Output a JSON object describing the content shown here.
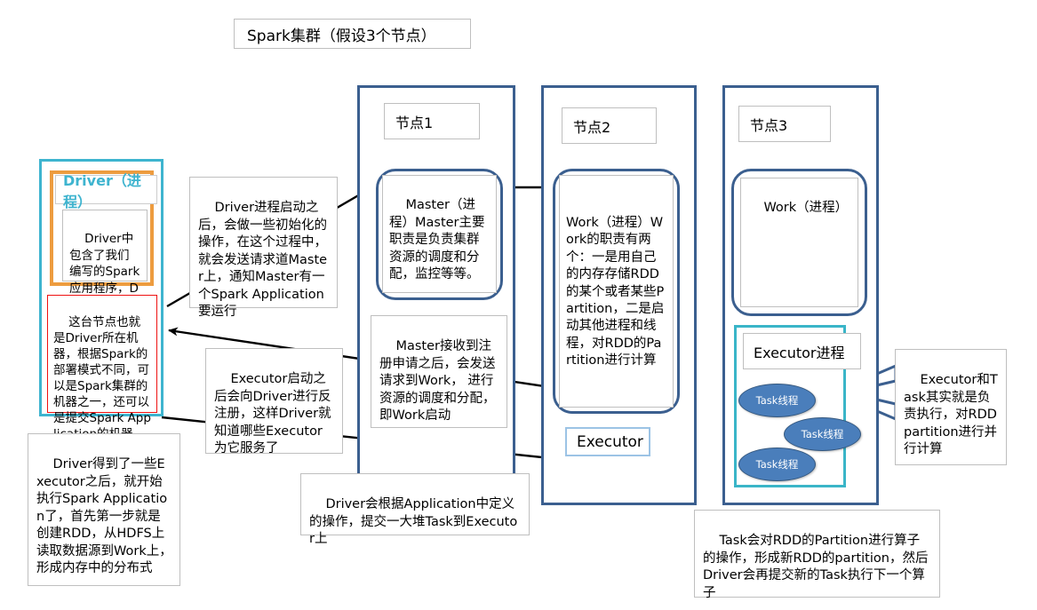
{
  "diagram": {
    "title_box": "Spark集群（假设3个节点）",
    "colors": {
      "node_border": "#3b5f8f",
      "driver_outer": "#3eb4cf",
      "driver_inner": "#ed9c3f",
      "red_note": "#ee1111",
      "executor_border": "#9cc3e5",
      "executor_proc_border": "#3ab5c8",
      "task_fill": "#4a7ebb",
      "arrow": "#000000",
      "callout": "#3b5f8f"
    },
    "driver_machine": {
      "title": "Driver（进程）",
      "body": "Driver中包含了我们编写的Spark应用程序，Driver负责提交。",
      "red_note": "这台节点也就是Driver所在机器，根据Spark的部署模式不同，可以是Spark集群的机器之一，还可以是提交Spark Application的机器"
    },
    "nodes": [
      {
        "label": "节点1",
        "process_title": "Master（进程）",
        "process_body": "Master主要职责是负责集群资源的调度和分配，监控等等。"
      },
      {
        "label": "节点2",
        "process_title": "Work（进程）",
        "process_body": "Work的职责有两个：一是用自己的内存存储RDD的某个或者某些Partition，二是启动其他进程和线程，对RDD的Partition进行计算"
      },
      {
        "label": "节点3",
        "process_title": "Work（进程）",
        "process_body": ""
      }
    ],
    "executor_box": "Executor",
    "executor_process": {
      "label": "Executor进程",
      "tasks": [
        "Task线程",
        "Task线程",
        "Task线程"
      ]
    },
    "notes": {
      "driver_start": "Driver进程启动之后，会做一些初始化的操作，在这个过程中，就会发送请求道Master上，通知Master有一个Spark Application要运行",
      "master_register": "Master接收到注册申请之后，会发送请求到Work， 进行资源的调度和分配，即Work启动",
      "executor_register": "Executor启动之后会向Driver进行反注册，这样Driver就知道哪些Executor为它服务了",
      "driver_got_executors": "Driver得到了一些Executor之后，就开始执行Spark Application了，首先第一步就是创建RDD，从HDFS上读取数据源到Work上，形成内存中的分布式",
      "driver_submit_tasks": "Driver会根据Application中定义的操作，提交一大堆Task到Executor上",
      "executor_task_role": "Executor和Task其实就是负责执行，对RDDpartition进行并行计算",
      "task_operator": "Task会对RDD的Partition进行算子的操作，形成新RDD的partition，然后Driver会再提交新的Task执行下一个算子"
    }
  }
}
